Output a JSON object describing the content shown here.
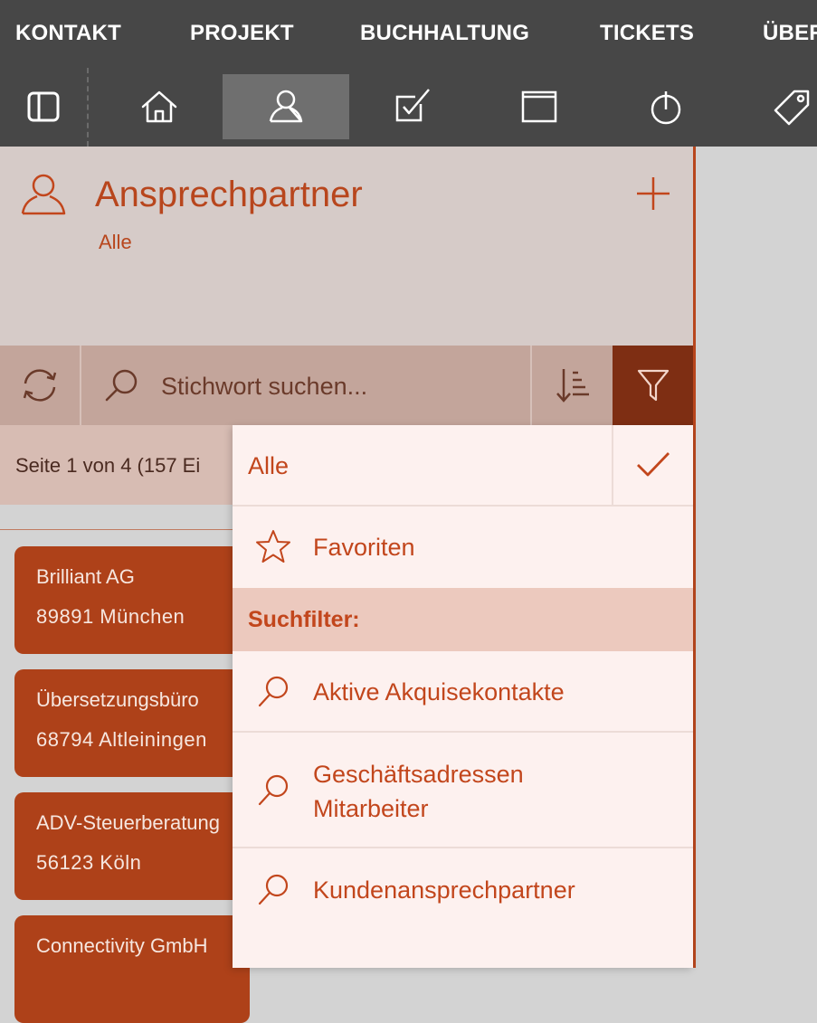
{
  "top_menu": {
    "items": [
      {
        "label": "KONTAKT"
      },
      {
        "label": "PROJEKT"
      },
      {
        "label": "BUCHHALTUNG"
      },
      {
        "label": "TICKETS"
      },
      {
        "label": "ÜBER"
      }
    ]
  },
  "toolbar": {
    "items": [
      {
        "icon": "sidebar-toggle-icon"
      },
      {
        "icon": "home-icon"
      },
      {
        "icon": "user-icon",
        "active": true
      },
      {
        "icon": "checkbox-icon"
      },
      {
        "icon": "window-icon"
      },
      {
        "icon": "stopwatch-icon"
      },
      {
        "icon": "tag-icon"
      }
    ]
  },
  "header": {
    "title": "Ansprechpartner",
    "subtitle": "Alle",
    "icon": "user-icon",
    "add_icon": "plus-icon"
  },
  "search": {
    "placeholder": "Stichwort suchen...",
    "refresh_icon": "refresh-icon",
    "search_icon": "search-icon",
    "sort_icon": "sort-icon",
    "filter_icon": "filter-icon"
  },
  "status": {
    "pagination": "Seite 1 von 4 (157 Ei"
  },
  "contacts": [
    {
      "name": "Brilliant AG",
      "location": "89891 München"
    },
    {
      "name": "Übersetzungsbüro",
      "location": "68794 Altleiningen"
    },
    {
      "name": "ADV-Steuerberatung",
      "location": "56123 Köln"
    },
    {
      "name": "Connectivity GmbH",
      "location": ""
    }
  ],
  "filter_dropdown": {
    "all_label": "Alle",
    "favorites_label": "Favoriten",
    "section_title": "Suchfilter:",
    "filters": [
      {
        "label": "Aktive Akquisekontakte"
      },
      {
        "label": "Geschäftsadressen",
        "label2": "Mitarbeiter"
      },
      {
        "label": "Kundenansprechpartner"
      }
    ]
  },
  "colors": {
    "accent": "#c2461c",
    "dark_bar": "#474747",
    "card": "#ae4119",
    "filter_active": "#7e2e13"
  }
}
